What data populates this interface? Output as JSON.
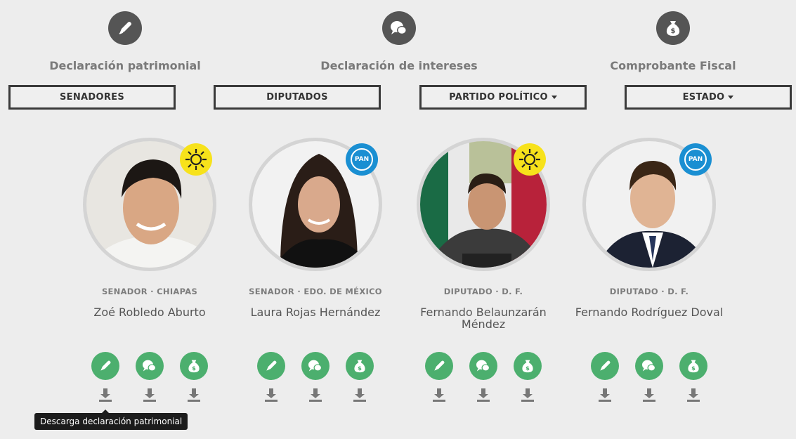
{
  "legend": [
    {
      "icon": "pen-icon",
      "label": "Declaración patrimonial"
    },
    {
      "icon": "chat-bubbles-icon",
      "label": "Declaración de intereses"
    },
    {
      "icon": "money-bag-icon",
      "label": "Comprobante Fiscal"
    }
  ],
  "filters": {
    "senadores": "SENADORES",
    "diputados": "DIPUTADOS",
    "partido": "PARTIDO POLÍTICO",
    "estado": "ESTADO"
  },
  "cards": [
    {
      "role": "SENADOR · CHIAPAS",
      "name": "Zoé Robledo Aburto",
      "party": "PRD"
    },
    {
      "role": "SENADOR · EDO. DE MÉXICO",
      "name": "Laura Rojas Hernández",
      "party": "PAN"
    },
    {
      "role": "DIPUTADO · D. F.",
      "name": "Fernando Belaunzarán Méndez",
      "party": "PRD"
    },
    {
      "role": "DIPUTADO · D. F.",
      "name": "Fernando Rodríguez Doval",
      "party": "PAN"
    }
  ],
  "badges": {
    "pan_text": "PAN"
  },
  "tooltip": "Descarga declaración patrimonial",
  "colors": {
    "action_green": "#4caf6e",
    "legend_gray": "#555555",
    "pan_blue": "#1a8fd2",
    "prd_yellow": "#f7e21b"
  }
}
